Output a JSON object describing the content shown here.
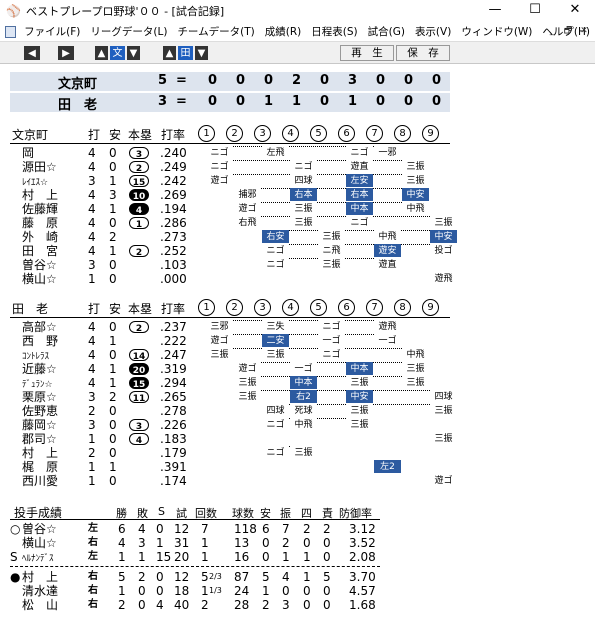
{
  "window": {
    "title": "ベストプレープロ野球'００ - [試合記録]",
    "min_glyph": "—",
    "max_glyph": "☐",
    "close_glyph": "✕",
    "app_icon_glyph": "⚾"
  },
  "menu": [
    "ファイル(F)",
    "リーグデータ(L)",
    "チームデータ(T)",
    "成績(R)",
    "日程表(S)",
    "試合(G)",
    "表示(V)",
    "ウィンドウ(W)",
    "ヘルプ(H)"
  ],
  "mdi": [
    "_",
    "🗗",
    "✕"
  ],
  "toolbar": {
    "left_arrow": "◀",
    "right_arrow": "▶",
    "up_arrow": "▲",
    "down_arrow": "▼",
    "bun": "文",
    "den": "田",
    "replay": "再　生",
    "save": "保　存"
  },
  "scoreboard": [
    {
      "team": "文京町",
      "runs": "5",
      "eq": "=",
      "innings": [
        "0",
        "0",
        "0",
        "2",
        "0",
        "3",
        "0",
        "0",
        "0"
      ]
    },
    {
      "team": "田　老",
      "runs": "3",
      "eq": "=",
      "innings": [
        "0",
        "0",
        "1",
        "1",
        "0",
        "1",
        "0",
        "0",
        "0"
      ]
    }
  ],
  "batting_headers": {
    "ab": "打",
    "h": "安",
    "hr": "本塁",
    "avg": "打率"
  },
  "inning_labels": [
    "1",
    "2",
    "3",
    "4",
    "5",
    "6",
    "7",
    "8",
    "9"
  ],
  "home": {
    "team": "文京町",
    "batters": [
      {
        "name": "岡",
        "small": false,
        "ab": "4",
        "h": "0",
        "hr": "3",
        "hrfill": false,
        "avg": ".240",
        "res": [
          [
            "ニゴ",
            false
          ],
          [
            "",
            false
          ],
          [
            "左飛",
            false
          ],
          [
            "",
            false
          ],
          [
            "",
            false
          ],
          [
            "ニゴ",
            false
          ],
          [
            "一邪",
            false
          ],
          [
            "",
            false
          ],
          [
            "",
            false
          ]
        ]
      },
      {
        "name": "源田☆",
        "small": false,
        "ab": "4",
        "h": "0",
        "hr": "2",
        "hrfill": false,
        "avg": ".249",
        "res": [
          [
            "ニゴ",
            false
          ],
          [
            "",
            false
          ],
          [
            "",
            false
          ],
          [
            "ニゴ",
            false
          ],
          [
            "",
            false
          ],
          [
            "遊直",
            false
          ],
          [
            "",
            false
          ],
          [
            "三振",
            false
          ],
          [
            "",
            false
          ]
        ]
      },
      {
        "name": "ﾚｲｴｽ☆",
        "small": true,
        "ab": "3",
        "h": "1",
        "hr": "15",
        "hrfill": false,
        "avg": ".242",
        "res": [
          [
            "遊ゴ",
            false
          ],
          [
            "",
            false
          ],
          [
            "",
            false
          ],
          [
            "四球",
            false
          ],
          [
            "",
            false
          ],
          [
            "左安",
            true
          ],
          [
            "",
            false
          ],
          [
            "三振",
            false
          ],
          [
            "",
            false
          ]
        ]
      },
      {
        "name": "村　上",
        "small": false,
        "ab": "4",
        "h": "3",
        "hr": "10",
        "hrfill": true,
        "avg": ".269",
        "res": [
          [
            "",
            false
          ],
          [
            "捕邪",
            false
          ],
          [
            "",
            false
          ],
          [
            "右本",
            true
          ],
          [
            "",
            false
          ],
          [
            "右本",
            true
          ],
          [
            "",
            false
          ],
          [
            "中安",
            true
          ],
          [
            "",
            false
          ]
        ]
      },
      {
        "name": "佐藤輝",
        "small": false,
        "ab": "4",
        "h": "1",
        "hr": "4",
        "hrfill": true,
        "avg": ".194",
        "res": [
          [
            "",
            false
          ],
          [
            "遊ゴ",
            false
          ],
          [
            "",
            false
          ],
          [
            "三振",
            false
          ],
          [
            "",
            false
          ],
          [
            "中本",
            true
          ],
          [
            "",
            false
          ],
          [
            "中飛",
            false
          ],
          [
            "",
            false
          ]
        ]
      },
      {
        "name": "藤　原",
        "small": false,
        "ab": "4",
        "h": "0",
        "hr": "1",
        "hrfill": false,
        "avg": ".286",
        "res": [
          [
            "",
            false
          ],
          [
            "右飛",
            false
          ],
          [
            "",
            false
          ],
          [
            "三振",
            false
          ],
          [
            "",
            false
          ],
          [
            "ニゴ",
            false
          ],
          [
            "",
            false
          ],
          [
            "",
            false
          ],
          [
            "三振",
            false
          ]
        ]
      },
      {
        "name": "外　崎",
        "small": false,
        "ab": "4",
        "h": "2",
        "hr": "",
        "hrfill": false,
        "avg": ".273",
        "res": [
          [
            "",
            false
          ],
          [
            "",
            false
          ],
          [
            "右安",
            true
          ],
          [
            "",
            false
          ],
          [
            "三振",
            false
          ],
          [
            "",
            false
          ],
          [
            "中飛",
            false
          ],
          [
            "",
            false
          ],
          [
            "中安",
            true
          ]
        ]
      },
      {
        "name": "田　宮",
        "small": false,
        "ab": "4",
        "h": "1",
        "hr": "2",
        "hrfill": false,
        "avg": ".252",
        "res": [
          [
            "",
            false
          ],
          [
            "",
            false
          ],
          [
            "ニゴ",
            false
          ],
          [
            "",
            false
          ],
          [
            "ニ飛",
            false
          ],
          [
            "",
            false
          ],
          [
            "遊安",
            true
          ],
          [
            "",
            false
          ],
          [
            "投ゴ",
            false
          ]
        ]
      },
      {
        "name": "曽谷☆",
        "small": false,
        "ab": "3",
        "h": "0",
        "hr": "",
        "hrfill": false,
        "avg": ".103",
        "res": [
          [
            "",
            false
          ],
          [
            "",
            false
          ],
          [
            "ニゴ",
            false
          ],
          [
            "",
            false
          ],
          [
            "三振",
            false
          ],
          [
            "",
            false
          ],
          [
            "遊直",
            false
          ],
          [
            "",
            false
          ],
          [
            "",
            false
          ]
        ]
      },
      {
        "name": "横山☆",
        "small": false,
        "ab": "1",
        "h": "0",
        "hr": "",
        "hrfill": false,
        "avg": ".000",
        "res": [
          [
            "",
            false
          ],
          [
            "",
            false
          ],
          [
            "",
            false
          ],
          [
            "",
            false
          ],
          [
            "",
            false
          ],
          [
            "",
            false
          ],
          [
            "",
            false
          ],
          [
            "",
            false
          ],
          [
            "遊飛",
            false
          ]
        ]
      }
    ]
  },
  "away": {
    "team": "田　老",
    "batters": [
      {
        "name": "高部☆",
        "small": false,
        "ab": "4",
        "h": "0",
        "hr": "2",
        "hrfill": false,
        "avg": ".237",
        "res": [
          [
            "三邪",
            false
          ],
          [
            "",
            false
          ],
          [
            "三失",
            false
          ],
          [
            "",
            false
          ],
          [
            "ニゴ",
            false
          ],
          [
            "",
            false
          ],
          [
            "遊飛",
            false
          ],
          [
            "",
            false
          ],
          [
            "",
            false
          ]
        ]
      },
      {
        "name": "西　野",
        "small": false,
        "ab": "4",
        "h": "1",
        "hr": "",
        "hrfill": false,
        "avg": ".222",
        "res": [
          [
            "遊ゴ",
            false
          ],
          [
            "",
            false
          ],
          [
            "二安",
            true
          ],
          [
            "",
            false
          ],
          [
            "一ゴ",
            false
          ],
          [
            "",
            false
          ],
          [
            "一ゴ",
            false
          ],
          [
            "",
            false
          ],
          [
            "",
            false
          ]
        ]
      },
      {
        "name": "ｺﾝﾄﾚﾗｽ",
        "small": true,
        "ab": "4",
        "h": "0",
        "hr": "14",
        "hrfill": false,
        "avg": ".247",
        "res": [
          [
            "三振",
            false
          ],
          [
            "",
            false
          ],
          [
            "三振",
            false
          ],
          [
            "",
            false
          ],
          [
            "ニゴ",
            false
          ],
          [
            "",
            false
          ],
          [
            "",
            false
          ],
          [
            "中飛",
            false
          ],
          [
            "",
            false
          ]
        ]
      },
      {
        "name": "近藤☆",
        "small": false,
        "ab": "4",
        "h": "1",
        "hr": "20",
        "hrfill": true,
        "avg": ".319",
        "res": [
          [
            "",
            false
          ],
          [
            "遊ゴ",
            false
          ],
          [
            "",
            false
          ],
          [
            "一ゴ",
            false
          ],
          [
            "",
            false
          ],
          [
            "中本",
            true
          ],
          [
            "",
            false
          ],
          [
            "三振",
            false
          ],
          [
            "",
            false
          ]
        ]
      },
      {
        "name": "ﾃﾞｭﾗﾝ☆",
        "small": true,
        "ab": "4",
        "h": "1",
        "hr": "15",
        "hrfill": true,
        "avg": ".294",
        "res": [
          [
            "",
            false
          ],
          [
            "三振",
            false
          ],
          [
            "",
            false
          ],
          [
            "中本",
            true
          ],
          [
            "",
            false
          ],
          [
            "三振",
            false
          ],
          [
            "",
            false
          ],
          [
            "三振",
            false
          ],
          [
            "",
            false
          ]
        ]
      },
      {
        "name": "栗原☆",
        "small": false,
        "ab": "3",
        "h": "2",
        "hr": "11",
        "hrfill": false,
        "avg": ".265",
        "res": [
          [
            "",
            false
          ],
          [
            "三振",
            false
          ],
          [
            "",
            false
          ],
          [
            "右2",
            true
          ],
          [
            "",
            false
          ],
          [
            "中安",
            true
          ],
          [
            "",
            false
          ],
          [
            "",
            false
          ],
          [
            "四球",
            false
          ]
        ]
      },
      {
        "name": "佐野恵",
        "small": false,
        "ab": "2",
        "h": "0",
        "hr": "",
        "hrfill": false,
        "avg": ".278",
        "res": [
          [
            "",
            false
          ],
          [
            "",
            false
          ],
          [
            "四球",
            false
          ],
          [
            "死球",
            false
          ],
          [
            "",
            false
          ],
          [
            "三振",
            false
          ],
          [
            "",
            false
          ],
          [
            "",
            false
          ],
          [
            "三振",
            false
          ]
        ]
      },
      {
        "name": "藤岡☆",
        "small": false,
        "ab": "3",
        "h": "0",
        "hr": "3",
        "hrfill": false,
        "avg": ".226",
        "res": [
          [
            "",
            false
          ],
          [
            "",
            false
          ],
          [
            "ニゴ",
            false
          ],
          [
            "中飛",
            false
          ],
          [
            "",
            false
          ],
          [
            "三振",
            false
          ],
          [
            "",
            false
          ],
          [
            "",
            false
          ],
          [
            "",
            false
          ]
        ]
      },
      {
        "name": "郡司☆",
        "small": false,
        "ab": "1",
        "h": "0",
        "hr": "4",
        "hrfill": false,
        "avg": ".183",
        "res": [
          [
            "",
            false
          ],
          [
            "",
            false
          ],
          [
            "",
            false
          ],
          [
            "",
            false
          ],
          [
            "",
            false
          ],
          [
            "",
            false
          ],
          [
            "",
            false
          ],
          [
            "",
            false
          ],
          [
            "三振",
            false
          ]
        ]
      },
      {
        "name": "村　上",
        "small": false,
        "ab": "2",
        "h": "0",
        "hr": "",
        "hrfill": false,
        "avg": ".179",
        "res": [
          [
            "",
            false
          ],
          [
            "",
            false
          ],
          [
            "ニゴ",
            false
          ],
          [
            "三振",
            false
          ],
          [
            "",
            false
          ],
          [
            "",
            false
          ],
          [
            "",
            false
          ],
          [
            "",
            false
          ],
          [
            "",
            false
          ]
        ]
      },
      {
        "name": "梶　原",
        "small": false,
        "ab": "1",
        "h": "1",
        "hr": "",
        "hrfill": false,
        "avg": ".391",
        "res": [
          [
            "",
            false
          ],
          [
            "",
            false
          ],
          [
            "",
            false
          ],
          [
            "",
            false
          ],
          [
            "",
            false
          ],
          [
            "",
            false
          ],
          [
            "左2",
            true
          ],
          [
            "",
            false
          ],
          [
            "",
            false
          ]
        ]
      },
      {
        "name": "西川愛",
        "small": false,
        "ab": "1",
        "h": "0",
        "hr": "",
        "hrfill": false,
        "avg": ".174",
        "res": [
          [
            "",
            false
          ],
          [
            "",
            false
          ],
          [
            "",
            false
          ],
          [
            "",
            false
          ],
          [
            "",
            false
          ],
          [
            "",
            false
          ],
          [
            "",
            false
          ],
          [
            "",
            false
          ],
          [
            "遊ゴ",
            false
          ]
        ]
      }
    ]
  },
  "pitching": {
    "title": "投手成績",
    "headers": [
      "勝",
      "敗",
      "S",
      "試",
      "回数",
      "球数",
      "安",
      "振",
      "四",
      "責",
      "防御率"
    ],
    "home": [
      {
        "mark": "○",
        "name": "曽谷☆",
        "hand": "左",
        "w": "6",
        "l": "4",
        "s": "0",
        "g": "12",
        "ip": "7",
        "ipf": "",
        "np": "118",
        "h": "6",
        "so": "7",
        "bb": "2",
        "er": "2",
        "era": "3.12"
      },
      {
        "mark": "",
        "name": "横山☆",
        "hand": "右",
        "w": "4",
        "l": "3",
        "s": "1",
        "g": "31",
        "ip": "1",
        "ipf": "",
        "np": "13",
        "h": "0",
        "so": "2",
        "bb": "0",
        "er": "0",
        "era": "3.52"
      },
      {
        "mark": "S",
        "name": "ﾍﾙﾅﾝﾃﾞｽ",
        "hand": "左",
        "w": "1",
        "l": "1",
        "s": "15",
        "g": "20",
        "ip": "1",
        "ipf": "",
        "np": "16",
        "h": "0",
        "so": "1",
        "bb": "1",
        "er": "0",
        "era": "2.08"
      }
    ],
    "away": [
      {
        "mark": "●",
        "name": "村　上",
        "hand": "右",
        "w": "5",
        "l": "2",
        "s": "0",
        "g": "12",
        "ip": "5",
        "ipf": "2/3",
        "np": "87",
        "h": "5",
        "so": "4",
        "bb": "1",
        "er": "5",
        "era": "3.70"
      },
      {
        "mark": "",
        "name": "清水達",
        "hand": "右",
        "w": "1",
        "l": "0",
        "s": "0",
        "g": "18",
        "ip": "1",
        "ipf": "1/3",
        "np": "24",
        "h": "1",
        "so": "0",
        "bb": "0",
        "er": "0",
        "era": "4.57"
      },
      {
        "mark": "",
        "name": "松　山",
        "hand": "右",
        "w": "2",
        "l": "0",
        "s": "4",
        "g": "40",
        "ip": "2",
        "ipf": "",
        "np": "28",
        "h": "2",
        "so": "3",
        "bb": "0",
        "er": "0",
        "era": "1.68"
      }
    ]
  }
}
